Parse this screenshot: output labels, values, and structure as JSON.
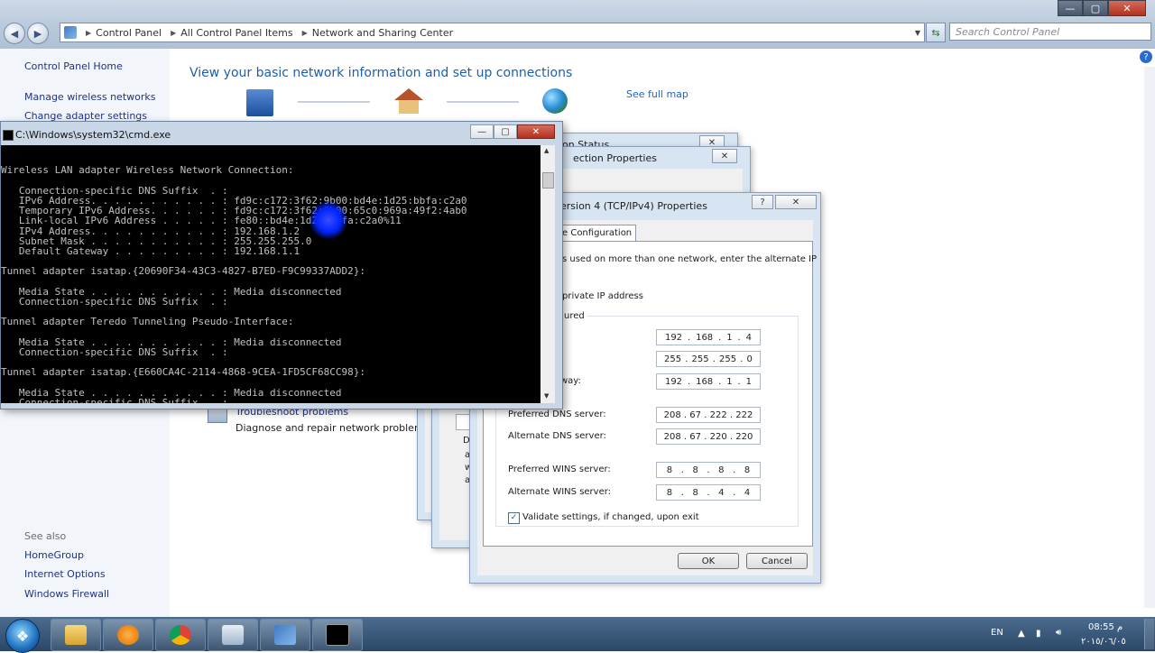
{
  "window": {
    "minimize": "—",
    "maximize": "▢",
    "close": "✕"
  },
  "addressbar": {
    "crumbs": [
      "Control Panel",
      "All Control Panel Items",
      "Network and Sharing Center"
    ],
    "search_placeholder": "Search Control Panel"
  },
  "sidebar": {
    "home": "Control Panel Home",
    "manage_wireless": "Manage wireless networks",
    "change_adapter": "Change adapter settings",
    "see_also": "See also",
    "homegroup": "HomeGroup",
    "internet_options": "Internet Options",
    "windows_firewall": "Windows Firewall"
  },
  "main": {
    "heading": "View your basic network information and set up connections",
    "see_full_map": "See full map",
    "troubleshoot": "Troubleshoot problems",
    "troubleshoot_desc": "Diagnose and repair network problems, o"
  },
  "dialogs": {
    "status_partial": "on Status",
    "conn_props_partial": "ection Properties",
    "ipv4_title": "ersion 4 (TCP/IPv4) Properties",
    "tab_alt_config": "e Configuration",
    "desc_partial": "s used on more than one network, enter the alternate IP",
    "private_ip": "private IP address",
    "configured_partial": "ured",
    "gateway_partial": "way:",
    "ip_address": [
      "192",
      "168",
      "1",
      "4"
    ],
    "subnet_mask": [
      "255",
      "255",
      "255",
      "0"
    ],
    "default_gateway": [
      "192",
      "168",
      "1",
      "1"
    ],
    "preferred_dns_label": "Preferred DNS server:",
    "preferred_dns": [
      "208",
      "67",
      "222",
      "222"
    ],
    "alternate_dns_label": "Alternate DNS server:",
    "alternate_dns": [
      "208",
      "67",
      "220",
      "220"
    ],
    "preferred_wins_label": "Preferred WINS server:",
    "preferred_wins": [
      "8",
      "8",
      "8",
      "8"
    ],
    "alternate_wins_label": "Alternate WINS server:",
    "alternate_wins": [
      "8",
      "8",
      "4",
      "4"
    ],
    "validate": "Validate settings, if changed, upon exit",
    "ok": "OK",
    "cancel": "Cancel",
    "side_d": "D",
    "side_a": "a",
    "side_w": "w",
    "side_a2": "a",
    "partial_t": "t"
  },
  "cmd": {
    "title": "C:\\Windows\\system32\\cmd.exe",
    "lines": [
      "Wireless LAN adapter Wireless Network Connection:",
      "",
      "   Connection-specific DNS Suffix  . :",
      "   IPv6 Address. . . . . . . . . . . : fd9c:c172:3f62:9b00:bd4e:1d25:bbfa:c2a0",
      "   Temporary IPv6 Address. . . . . . : fd9c:c172:3f62:9b00:65c0:969a:49f2:4ab0",
      "   Link-local IPv6 Address . . . . . : fe80::bd4e:1d25:bbfa:c2a0%11",
      "   IPv4 Address. . . . . . . . . . . : 192.168.1.2",
      "   Subnet Mask . . . . . . . . . . . : 255.255.255.0",
      "   Default Gateway . . . . . . . . . : 192.168.1.1",
      "",
      "Tunnel adapter isatap.{20690F34-43C3-4827-B7ED-F9C99337ADD2}:",
      "",
      "   Media State . . . . . . . . . . . : Media disconnected",
      "   Connection-specific DNS Suffix  . :",
      "",
      "Tunnel adapter Teredo Tunneling Pseudo-Interface:",
      "",
      "   Media State . . . . . . . . . . . : Media disconnected",
      "   Connection-specific DNS Suffix  . :",
      "",
      "Tunnel adapter isatap.{E660CA4C-2114-4868-9CEA-1FD5CF68CC98}:",
      "",
      "   Media State . . . . . . . . . . . : Media disconnected",
      "   Connection-specific DNS Suffix  . :"
    ]
  },
  "tray": {
    "lang": "EN",
    "time": "08:55 م",
    "date": "٢٠١٥/٠٦/٠٥"
  }
}
